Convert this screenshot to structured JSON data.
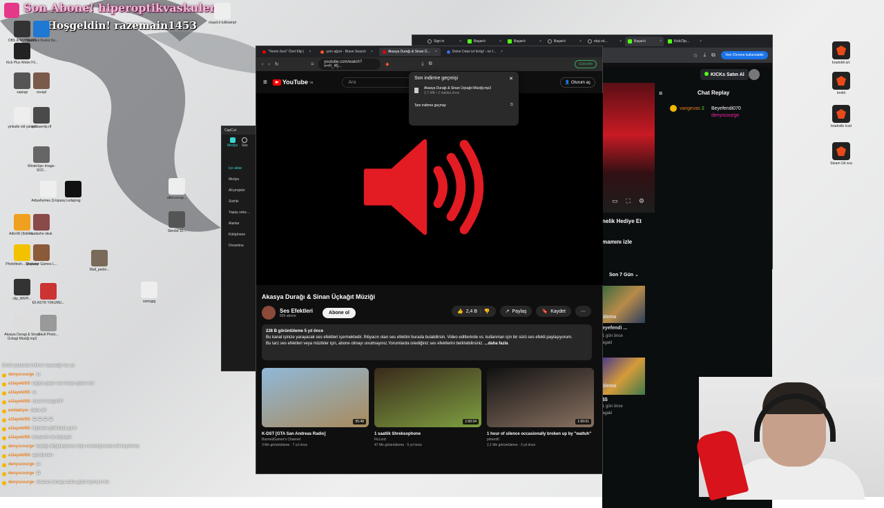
{
  "alerts": {
    "line1": "Son Abone! hiperoptikvaskuler",
    "line2": "Hoşgeldin! razemain1453"
  },
  "desktop_icons": [
    "OBS & NVI Studio",
    "Hdpi Plus Kuzey Ke...",
    "Kick Plus Webe Fit...",
    "vapiagi",
    "cevapl",
    "yinkutle old yamptl",
    "andaserlip.rtf",
    "WindoSpo Image-SO2...",
    "Adisahumeu Q-tspasy",
    "Ledaprag",
    "aftercorrap...",
    "AdisVili (Ilobikti...",
    "andaxhe okuk",
    "Stenbd 11...",
    "Photofinsh... Qtspasy",
    "Rockstar Games L...",
    "Wall_pertin...",
    "clip_WKPI...",
    "E5 ASTR Y0KUMU...",
    "vamsjpg",
    "Akasya Duragi & Sinan Ückagt Müziğl.mp3",
    "Skull Photo...",
    "ckayd.d tuiltsampt",
    "orhan_furu..."
  ],
  "right_icons": [
    "bradoblt a/c",
    "brolid",
    "bradodls Icod",
    "Steam Glt oca"
  ],
  "chat_log": [
    {
      "user": "denyscourge",
      "msg": "ss"
    },
    {
      "user": "a1layekil55",
      "msg": "bağırtı geçin seni kuran güzel olur"
    },
    {
      "user": "a1layekil55",
      "msg": "ss"
    },
    {
      "user": "a1layekil55",
      "msg": "cosel el begebil?"
    },
    {
      "user": "emilakiyer",
      "msg": "daha alit"
    },
    {
      "user": "a1layekil55",
      "msg": "😀 😀 😀 😀"
    },
    {
      "user": "a1layekil55",
      "msg": "hiçbeme göhl back ya lli"
    },
    {
      "user": "a1layekil55",
      "msg": "bunyenin da böyleydi"
    },
    {
      "user": "denyscourge",
      "msg": "başlığı değiştiriyorsun diye modalığımızda dili kaydetmiş"
    },
    {
      "user": "a1layekil55",
      "msg": "ayında ben"
    },
    {
      "user": "denyscourge",
      "msg": "ss"
    },
    {
      "user": "denyscourge",
      "msg": "😀"
    },
    {
      "user": "denyscourge",
      "msg": "rahatsız olmaya daha güzel eymiş bi de"
    }
  ],
  "chat_overlay_top": "Sinde yazanda indirme sayacağı var ya",
  "capcut": {
    "title": "CapCut",
    "tabs": [
      "Medya",
      "Ses"
    ],
    "nav": [
      "İçe aktar",
      "Medya",
      "Alt projeler",
      "Sizinki",
      "Yapay zeka ...",
      "Alanlar",
      "Kütüphane",
      "Dreamina"
    ]
  },
  "back_browser": {
    "tabs": [
      "Sign in",
      "Başarılı",
      "Başarılı",
      "Başarılı",
      "ekşi sö...",
      "Başarılı",
      "KickClip..."
    ],
    "chrome_btn": "Yeni Chrome kullanılabilir"
  },
  "kick": {
    "buy_btn": "KICKs Satın Al",
    "chat_replay": "Chat Replay",
    "replay_users": [
      "vangevas",
      "Beyefendi070",
      "denyscourge"
    ],
    "replay_counts": [
      "2"
    ],
    "gift": "nelik Hediye Et",
    "watch": "mamını izle",
    "period": "Son 7 Gün",
    "items": [
      {
        "a": "ülema",
        "b": "eyefendi ...",
        "c": "1 gün önce",
        "d": "agakl"
      },
      {
        "a": "ülema",
        "b": "$$",
        "c": "1 gün önce",
        "d": "agakl"
      }
    ]
  },
  "main_browser": {
    "tabs": [
      "\"Yenim Sexi\" Özel Klip |",
      "şom ağızlı - Brave Search",
      "Akasya Durağı & Sinan Ü...",
      "Deine Datei ist fertig! - ne f..."
    ],
    "url": "youtube.com/watch?v=H_4fj...",
    "update_btn": "Güncelle"
  },
  "youtube": {
    "logo": "YouTube",
    "logo_sup": "TR",
    "search_placeholder": "Ara",
    "signin": "Oturum aç",
    "title": "Akasya Durağı & Sinan Üçkağıt Müziği",
    "channel": "Ses Efektleri",
    "subs": "839 abone",
    "subscribe": "Abone ol",
    "likes": "2,4 B",
    "share": "Paylaş",
    "save": "Kaydet",
    "views": "228 B görüntüleme  5 yıl önce",
    "desc1": "Bu kanal işinize yarayacak ses efektleri içermektedir. İhtiyacın olan ses efektini burada bulabilirsin. Video editlerinde vs. kullanman için bir sürü ses efekti paylaşıyorum.",
    "desc2": "Bu tarz ses efektleri veya müzikler için, abone olmayı unutmayınız.Yorumlarda istediğiniz ses efektlerini belirtebilirsiniz.",
    "more": "...daha fazla",
    "recs": [
      {
        "title": "K-DST [GTA San Andreas Radio]",
        "channel": "BannedGamer's Channel",
        "meta": "3 Mn görüntüleme · 7 yıl önce",
        "dur": "55:48",
        "c1": "#8fb8d8",
        "c2": "#a98b5c"
      },
      {
        "title": "1 saatlik Shreksophone",
        "channel": "FicLord",
        "meta": "47 Mn görüntüleme · 5 yıl önce",
        "dur": "1:00:34",
        "c1": "#3a2a1c",
        "c2": "#7ea040"
      },
      {
        "title": "1 hour of silence occasionally broken up by \"waltuh\"",
        "channel": "piment0",
        "meta": "2,1 Mn görüntüleme · 3 yıl önce",
        "dur": "1:00:01",
        "c1": "#111",
        "c2": "#8a7262"
      }
    ]
  },
  "download_panel": {
    "heading": "Son indirme geçmişi",
    "file": "Akasya Durağı & Sinan Üçkağıt Müziği.mp3",
    "size": "2,7 MB • 2 dakika önce",
    "all": "Tam indirme geçmişi"
  },
  "colors": {
    "yt_red": "#ff0000",
    "kick_green": "#53fc18",
    "link_blue": "#3ea6ff"
  }
}
